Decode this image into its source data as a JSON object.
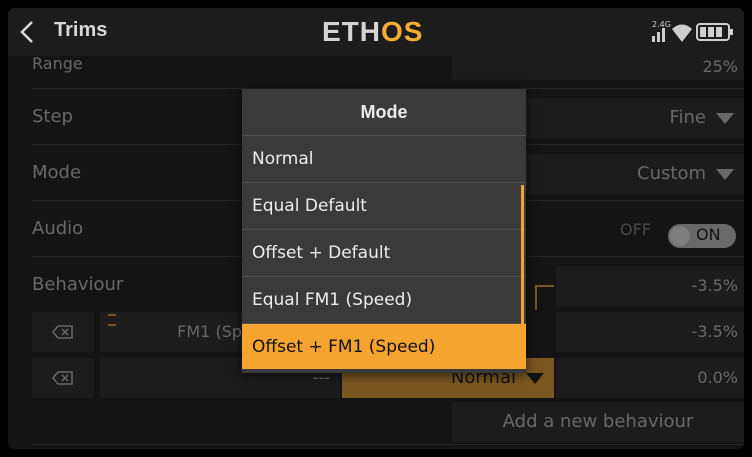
{
  "header": {
    "title": "Trims",
    "logo_part1": "ETH",
    "logo_part2": "OS",
    "band": "2.4G"
  },
  "rows": {
    "range_label": "Range",
    "range_value": "25%",
    "step_label": "Step",
    "step_value": "Fine",
    "mode_label": "Mode",
    "mode_value": "Custom",
    "audio_label": "Audio",
    "audio_off": "OFF",
    "audio_on": "ON",
    "behaviour_label": "Behaviour"
  },
  "behaviours": [
    {
      "source": "FM1 (Sp",
      "value": "-3.5%"
    },
    {
      "source": "---",
      "mode": "Normal",
      "value": "0.0%"
    }
  ],
  "behaviour_header_value": "-3.5%",
  "add_behaviour": "Add a new behaviour",
  "modal": {
    "title": "Mode",
    "options": [
      "Normal",
      "Equal Default",
      "Offset + Default",
      "Equal FM1 (Speed)",
      "Offset + FM1 (Speed)"
    ],
    "selected_index": 4
  },
  "colors": {
    "accent": "#f4a42f",
    "background": "#141414",
    "field": "#262626"
  }
}
